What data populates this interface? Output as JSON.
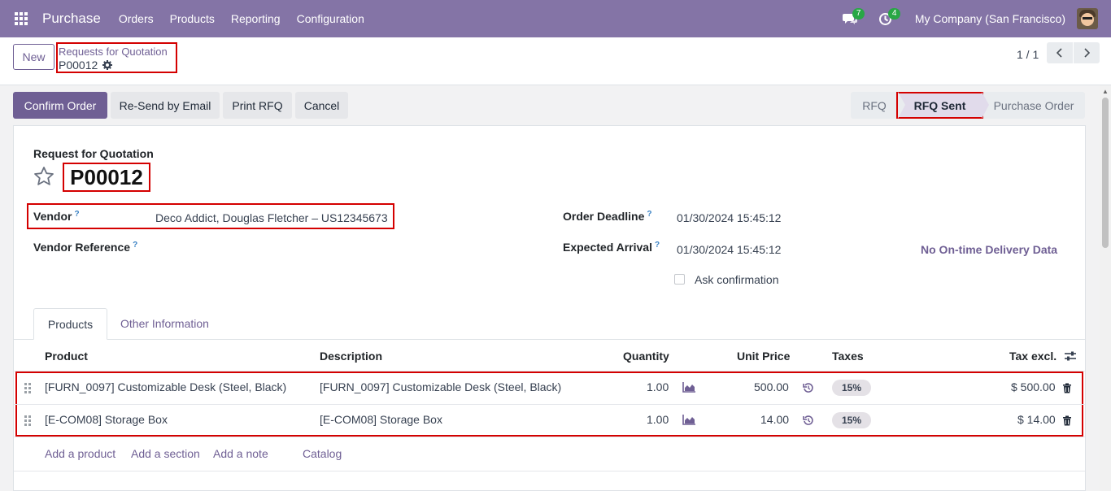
{
  "navbar": {
    "app_name": "Purchase",
    "menu": [
      "Orders",
      "Products",
      "Reporting",
      "Configuration"
    ],
    "messages_count": "7",
    "activities_count": "4",
    "company": "My Company (San Francisco)"
  },
  "control": {
    "new_label": "New",
    "breadcrumb_parent": "Requests for Quotation",
    "breadcrumb_current": "P00012",
    "pager": "1 / 1"
  },
  "actions": {
    "confirm": "Confirm Order",
    "resend": "Re-Send by Email",
    "print": "Print RFQ",
    "cancel": "Cancel"
  },
  "statusbar": [
    "RFQ",
    "RFQ Sent",
    "Purchase Order"
  ],
  "form": {
    "doc_type": "Request for Quotation",
    "name": "P00012",
    "vendor_label": "Vendor",
    "vendor_value": "Deco Addict, Douglas Fletcher – US12345673",
    "vendor_ref_label": "Vendor Reference",
    "order_deadline_label": "Order Deadline",
    "order_deadline_value": "01/30/2024 15:45:12",
    "expected_arrival_label": "Expected Arrival",
    "expected_arrival_value": "01/30/2024 15:45:12",
    "ontime_label": "No On-time Delivery Data",
    "ask_confirmation_label": "Ask confirmation",
    "help_mark": "?"
  },
  "tabs": [
    "Products",
    "Other Information"
  ],
  "table": {
    "headers": [
      "Product",
      "Description",
      "Quantity",
      "Unit Price",
      "Taxes",
      "Tax excl."
    ],
    "rows": [
      {
        "product": "[FURN_0097] Customizable Desk (Steel, Black)",
        "description": "[FURN_0097] Customizable Desk (Steel, Black)",
        "quantity": "1.00",
        "unit_price": "500.00",
        "tax": "15%",
        "subtotal": "$ 500.00"
      },
      {
        "product": "[E-COM08] Storage Box",
        "description": "[E-COM08] Storage Box",
        "quantity": "1.00",
        "unit_price": "14.00",
        "tax": "15%",
        "subtotal": "$ 14.00"
      }
    ],
    "add_links": [
      "Add a product",
      "Add a section",
      "Add a note",
      "Catalog"
    ]
  },
  "colors": {
    "brand": "#8474a6",
    "primary": "#6f5f94",
    "highlight": "#d40000"
  }
}
